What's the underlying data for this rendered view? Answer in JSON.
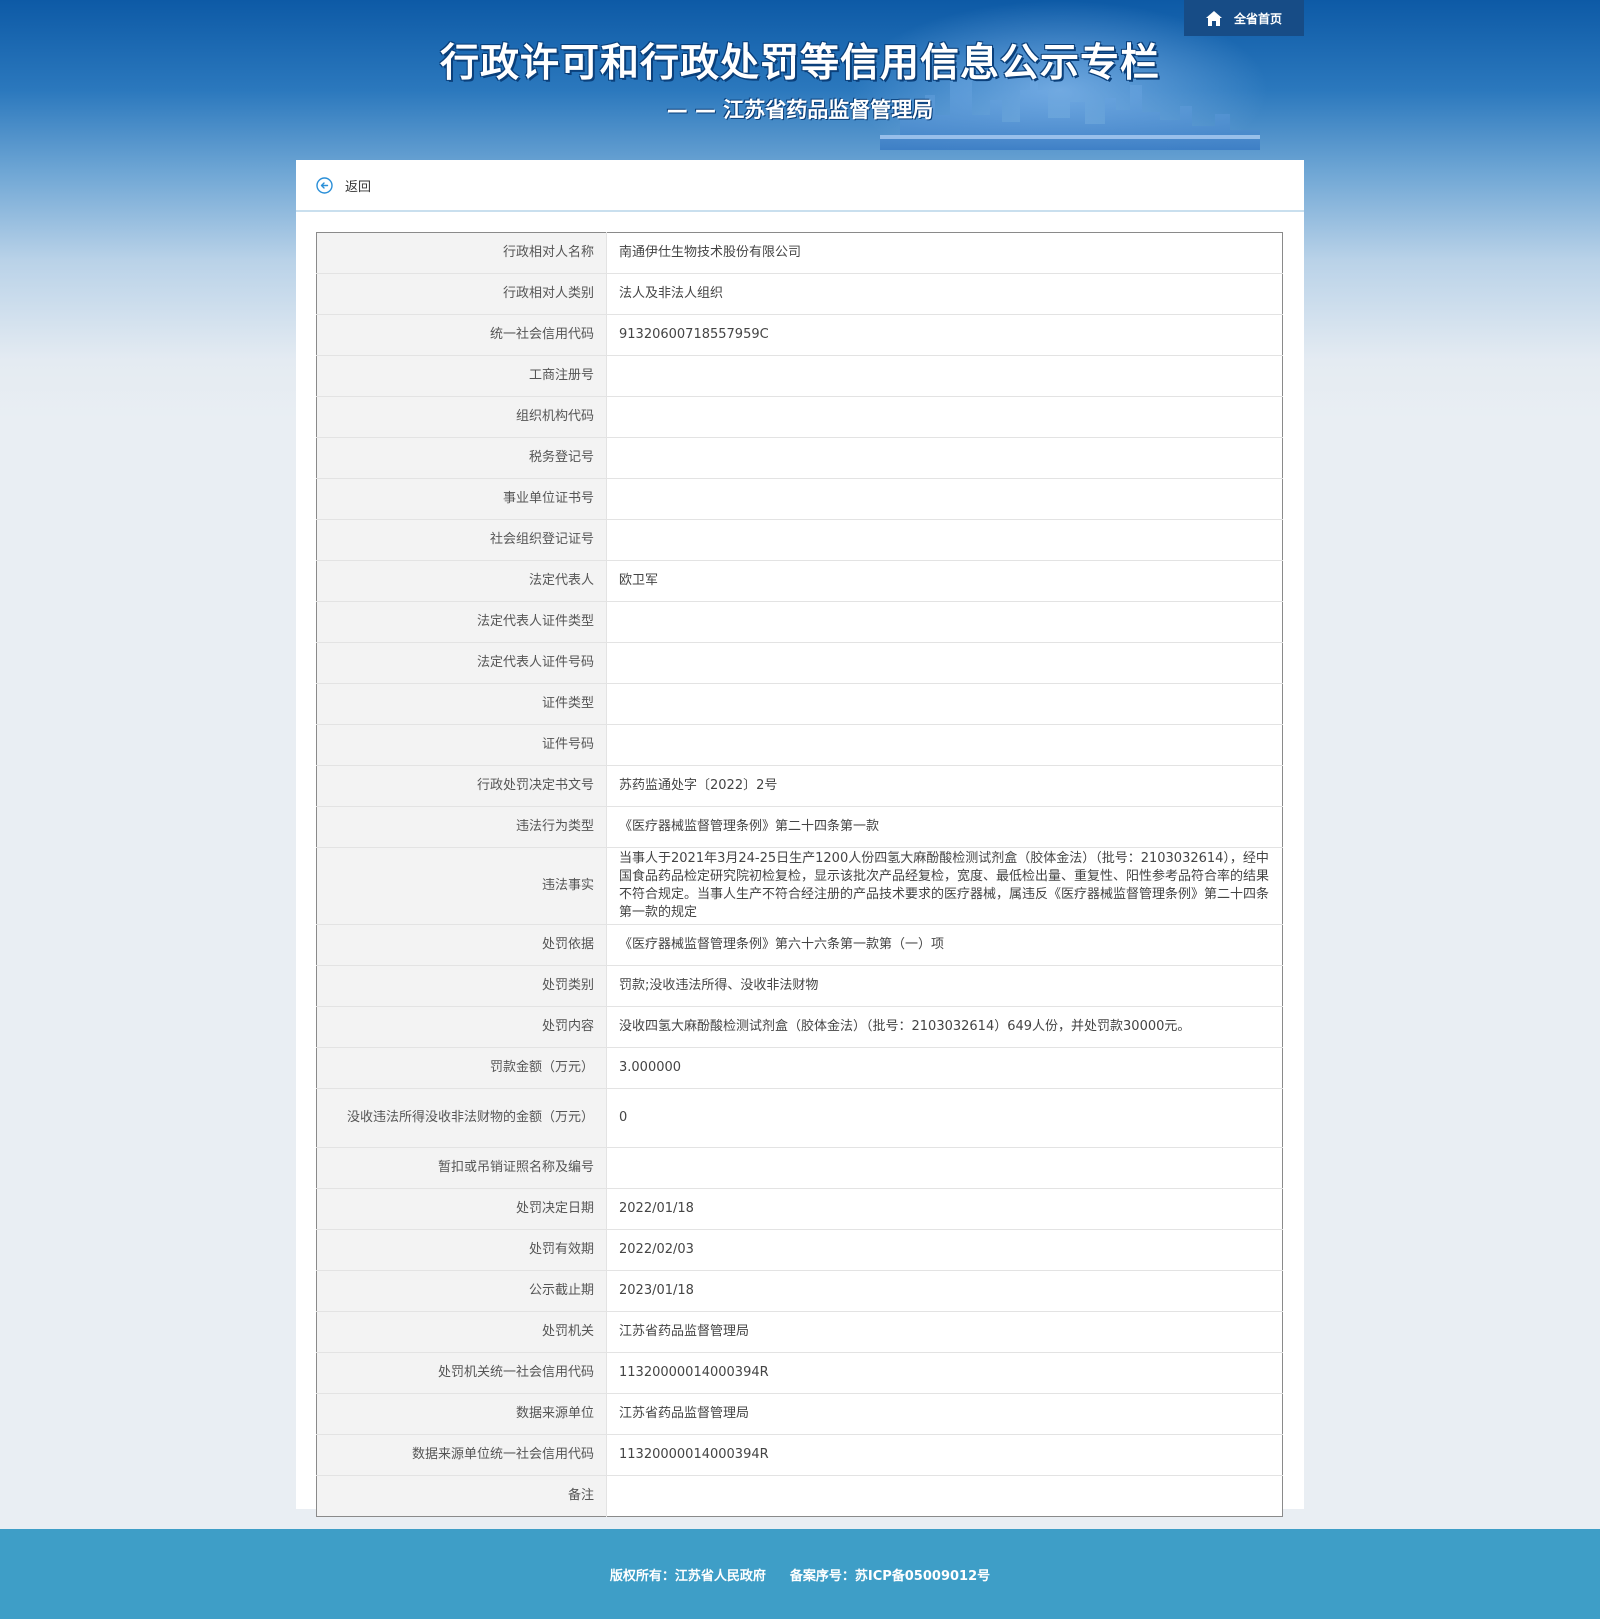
{
  "header": {
    "title": "行政许可和行政处罚等信用信息公示专栏",
    "subtitle": "— — 江苏省药品监督管理局",
    "home_label": "全省首页"
  },
  "nav": {
    "back_label": "返回"
  },
  "rows": [
    {
      "label": "行政相对人名称",
      "value": "南通伊仕生物技术股份有限公司"
    },
    {
      "label": "行政相对人类别",
      "value": "法人及非法人组织"
    },
    {
      "label": "统一社会信用代码",
      "value": "91320600718557959C"
    },
    {
      "label": "工商注册号",
      "value": ""
    },
    {
      "label": "组织机构代码",
      "value": ""
    },
    {
      "label": "税务登记号",
      "value": ""
    },
    {
      "label": "事业单位证书号",
      "value": ""
    },
    {
      "label": "社会组织登记证号",
      "value": ""
    },
    {
      "label": "法定代表人",
      "value": "欧卫军"
    },
    {
      "label": "法定代表人证件类型",
      "value": ""
    },
    {
      "label": "法定代表人证件号码",
      "value": ""
    },
    {
      "label": "证件类型",
      "value": ""
    },
    {
      "label": "证件号码",
      "value": ""
    },
    {
      "label": "行政处罚决定书文号",
      "value": "苏药监通处字〔2022〕2号"
    },
    {
      "label": "违法行为类型",
      "value": "《医疗器械监督管理条例》第二十四条第一款"
    },
    {
      "label": "违法事实",
      "value": "当事人于2021年3月24-25日生产1200人份四氢大麻酚酸检测试剂盒（胶体金法）（批号：2103032614），经中国食品药品检定研究院初检复检，显示该批次产品经复检，宽度、最低检出量、重复性、阳性参考品符合率的结果不符合规定。当事人生产不符合经注册的产品技术要求的医疗器械，属违反《医疗器械监督管理条例》第二十四条第一款的规定"
    },
    {
      "label": "处罚依据",
      "value": "《医疗器械监督管理条例》第六十六条第一款第（一）项"
    },
    {
      "label": "处罚类别",
      "value": "罚款;没收违法所得、没收非法财物"
    },
    {
      "label": "处罚内容",
      "value": "没收四氢大麻酚酸检测试剂盒（胶体金法）（批号：2103032614）649人份，并处罚款30000元。"
    },
    {
      "label": "罚款金额（万元）",
      "value": "3.000000"
    },
    {
      "label": "没收违法所得没收非法财物的金额（万元）",
      "value": "0"
    },
    {
      "label": "暂扣或吊销证照名称及编号",
      "value": ""
    },
    {
      "label": "处罚决定日期",
      "value": "2022/01/18"
    },
    {
      "label": "处罚有效期",
      "value": "2022/02/03"
    },
    {
      "label": "公示截止期",
      "value": "2023/01/18"
    },
    {
      "label": "处罚机关",
      "value": "江苏省药品监督管理局"
    },
    {
      "label": "处罚机关统一社会信用代码",
      "value": "11320000014000394R"
    },
    {
      "label": "数据来源单位",
      "value": "江苏省药品监督管理局"
    },
    {
      "label": "数据来源单位统一社会信用代码",
      "value": "11320000014000394R"
    },
    {
      "label": "备注",
      "value": ""
    }
  ],
  "footer": {
    "copyright": "版权所有：江苏省人民政府",
    "icp": "备案序号：苏ICP备05009012号"
  },
  "colors": {
    "footer_bg": "#3e9ec7",
    "home_btn_bg": "#174c86",
    "accent": "#2a8fd8"
  }
}
